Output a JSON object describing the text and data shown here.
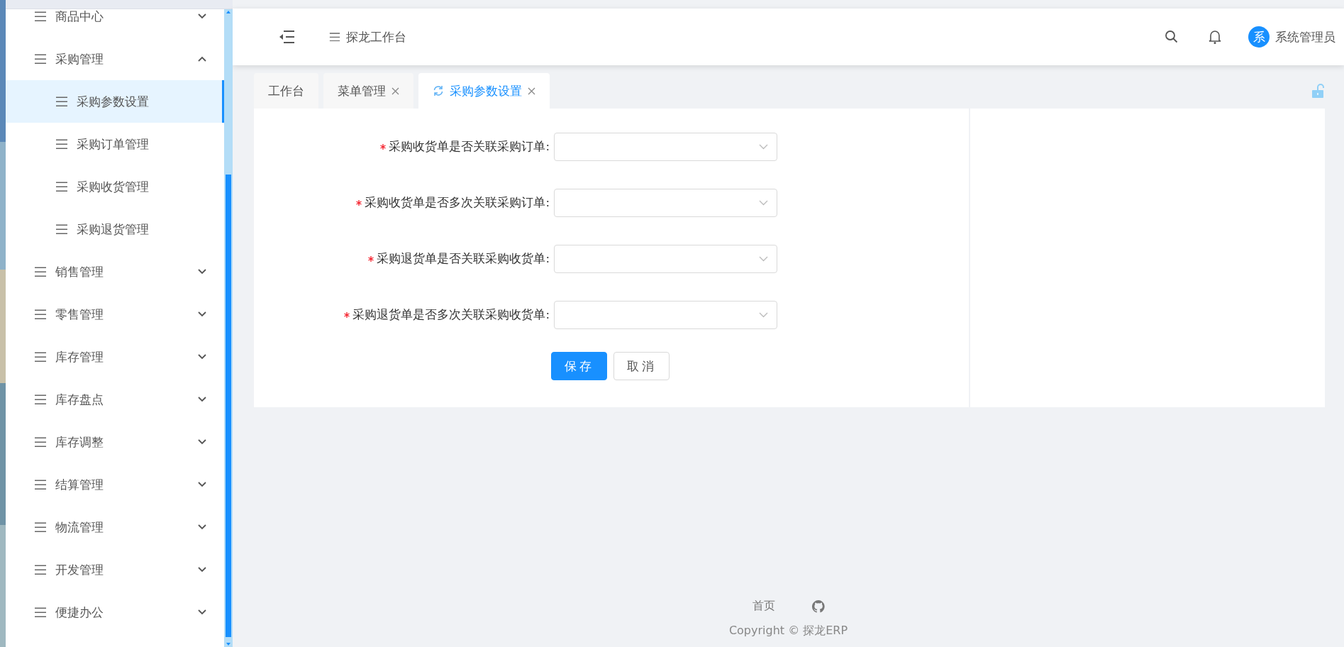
{
  "sidebar": {
    "items": [
      {
        "label": "商品中心",
        "expanded": false
      },
      {
        "label": "采购管理",
        "expanded": true,
        "children": [
          {
            "label": "采购参数设置",
            "selected": true
          },
          {
            "label": "采购订单管理",
            "selected": false
          },
          {
            "label": "采购收货管理",
            "selected": false
          },
          {
            "label": "采购退货管理",
            "selected": false
          }
        ]
      },
      {
        "label": "销售管理",
        "expanded": false
      },
      {
        "label": "零售管理",
        "expanded": false
      },
      {
        "label": "库存管理",
        "expanded": false
      },
      {
        "label": "库存盘点",
        "expanded": false
      },
      {
        "label": "库存调整",
        "expanded": false
      },
      {
        "label": "结算管理",
        "expanded": false
      },
      {
        "label": "物流管理",
        "expanded": false
      },
      {
        "label": "开发管理",
        "expanded": false
      },
      {
        "label": "便捷办公",
        "expanded": false
      }
    ]
  },
  "header": {
    "breadcrumb": "探龙工作台",
    "avatar": "系",
    "user": "系统管理员"
  },
  "tabs": [
    {
      "label": "工作台",
      "selected": false,
      "closable": false
    },
    {
      "label": "菜单管理",
      "selected": false,
      "closable": true
    },
    {
      "label": "采购参数设置",
      "selected": true,
      "closable": true
    }
  ],
  "form": {
    "fields": [
      {
        "label": "采购收货单是否关联采购订单:",
        "required": true
      },
      {
        "label": "采购收货单是否多次关联采购订单:",
        "required": true
      },
      {
        "label": "采购退货单是否关联采购收货单:",
        "required": true
      },
      {
        "label": "采购退货单是否多次关联采购收货单:",
        "required": true
      }
    ],
    "buttons": [
      {
        "label": "保存",
        "kind": "primary"
      },
      {
        "label": "取消",
        "kind": "default"
      }
    ]
  },
  "footer": {
    "link": "首页",
    "copyright": "Copyright © 探龙ERP"
  }
}
